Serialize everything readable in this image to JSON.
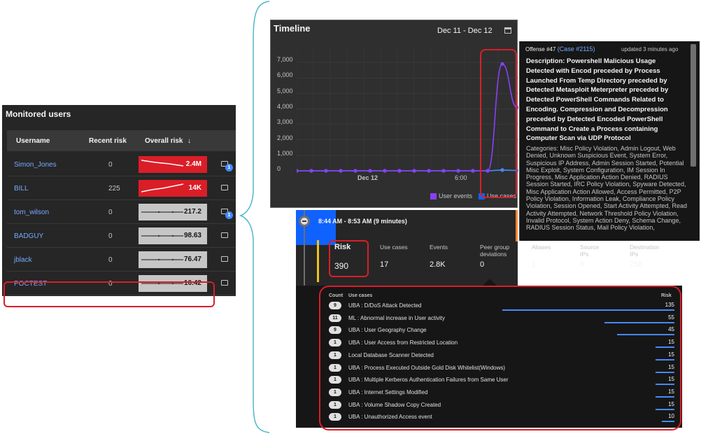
{
  "users_panel": {
    "title": "Monitored users",
    "columns": [
      "Username",
      "Recent risk",
      "Overall risk"
    ],
    "sort_arrow": "↓",
    "rows": [
      {
        "username": "Simon_Jones",
        "recent_risk": "0",
        "overall_risk": "2.4M",
        "trend": "down",
        "highlight": true,
        "case_badge": "1"
      },
      {
        "username": "BILL",
        "recent_risk": "225",
        "overall_risk": "14K",
        "trend": "up",
        "highlight": true,
        "case_badge": ""
      },
      {
        "username": "tom_wilson",
        "recent_risk": "0",
        "overall_risk": "217.2",
        "trend": "flat",
        "highlight": false,
        "case_badge": "1"
      },
      {
        "username": "BADGUY",
        "recent_risk": "0",
        "overall_risk": "98.63",
        "trend": "flat",
        "highlight": false,
        "case_badge": ""
      },
      {
        "username": "jblack",
        "recent_risk": "0",
        "overall_risk": "76.47",
        "trend": "flat",
        "highlight": false,
        "case_badge": ""
      },
      {
        "username": "POCTEST",
        "recent_risk": "0",
        "overall_risk": "16.42",
        "trend": "flat",
        "highlight": false,
        "case_badge": ""
      }
    ]
  },
  "timeline": {
    "title": "Timeline",
    "date_range": "Dec 11 - Dec 12",
    "calendar_icon": "calendar-icon",
    "y_ticks": [
      "7,000",
      "6,000",
      "5,000",
      "4,000",
      "3,000",
      "2,000",
      "1,000",
      "0"
    ],
    "x_labels": [
      "Dec 12",
      "6:00"
    ],
    "legend": [
      {
        "label": "User events",
        "color": "#8a3ffc"
      },
      {
        "label": "Use cases",
        "color": "#0f62fe"
      }
    ],
    "chart_data": {
      "type": "line",
      "ylim": [
        0,
        8000
      ],
      "series": [
        {
          "name": "User events",
          "color": "#8a3ffc",
          "values": [
            0,
            0,
            0,
            0,
            0,
            0,
            0,
            0,
            0,
            0,
            0,
            0,
            0,
            0,
            6900,
            4100
          ]
        },
        {
          "name": "Use cases",
          "color": "#4589ff",
          "values": [
            0,
            0,
            0,
            0,
            0,
            0,
            0,
            0,
            0,
            0,
            0,
            0,
            0,
            0,
            50,
            20
          ]
        }
      ]
    }
  },
  "offense": {
    "offense_id": "Offense #47",
    "case_link": "(Case #2115)",
    "updated": "updated 3 minutes ago",
    "description": "Description: Powershell Malicious Usage Detected with Encod preceded by Process Launched From Temp Directory preceded by Detected Metasploit Meterpreter preceded by Detected PowerShell Commands Related to Encoding. Compression and Decompression preceded by Detected Encoded PowerShell Command to Create a Process containing Computer Scan via UDP Protocol",
    "categories": "Categories: Misc Policy Violation, Admin Logout, Web Denied, Unknown Suspicious Event, System Error, Suspicious IP Address, Admin Session Started, Potential Misc Exploit, System Configuration, IM Session In Progress, Misc Application Action Denied, RADIUS Session Started, IRC Policy Violation, Spyware Detected, Misc Application Action Allowed, Access Permitted, P2P Policy Violation, Information Leak, Compliance Policy Violation, Session Opened, Start Activity Attempted, Read Activity Attempted, Network Threshold Policy Violation, Invalid Protocol, System Action Deny, Schema Change, RADIUS Session Status, Mail Policy Violation,"
  },
  "summary": {
    "time_range": "8:44 AM - 8:53 AM (9 minutes)",
    "stats": [
      {
        "label": "Risk",
        "value": "390"
      },
      {
        "label": "Use cases",
        "value": "17"
      },
      {
        "label": "Events",
        "value": "2.8K"
      },
      {
        "label": "Peer group deviations",
        "value": "0"
      },
      {
        "label": "Aliases",
        "value": "1"
      },
      {
        "label": "Source IPs",
        "value": "6"
      },
      {
        "label": "Destination IPs",
        "value": "258"
      }
    ]
  },
  "use_cases": {
    "headers": {
      "count": "Count",
      "use_cases": "Use cases",
      "risk": "Risk"
    },
    "rows": [
      {
        "count": "9",
        "name": "UBA : D/DoS Attack Detected",
        "risk": "135",
        "bar": 1.0
      },
      {
        "count": "11",
        "name": "ML : Abnormal increase in User activity",
        "risk": "55",
        "bar": 0.407
      },
      {
        "count": "9",
        "name": "UBA : User Geography Change",
        "risk": "45",
        "bar": 0.333
      },
      {
        "count": "1",
        "name": "UBA : User Access from Restricted Location",
        "risk": "15",
        "bar": 0.111
      },
      {
        "count": "1",
        "name": "Local Database Scanner Detected",
        "risk": "15",
        "bar": 0.111
      },
      {
        "count": "1",
        "name": "UBA : Process Executed Outside Gold Disk Whitelist(Windows)",
        "risk": "15",
        "bar": 0.111
      },
      {
        "count": "1",
        "name": "UBA : Multiple Kerberos Authentication Failures from Same User",
        "risk": "15",
        "bar": 0.111
      },
      {
        "count": "1",
        "name": "UBA : Internet Settings Modified",
        "risk": "15",
        "bar": 0.111
      },
      {
        "count": "1",
        "name": "UBA : Volume Shadow Copy Created",
        "risk": "15",
        "bar": 0.111
      },
      {
        "count": "1",
        "name": "UBA : Unauthorized Access event",
        "risk": "10",
        "bar": 0.074
      }
    ]
  }
}
